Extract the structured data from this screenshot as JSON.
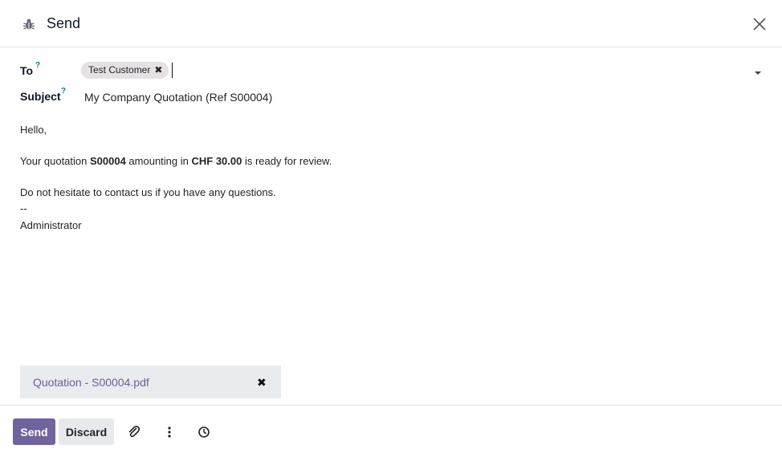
{
  "dialog": {
    "title": "Send",
    "title_icon": "bug-icon",
    "close_icon": "close-icon"
  },
  "to": {
    "label": "To",
    "help": "?",
    "recipients": [
      {
        "name": "Test Customer",
        "remove": "✖"
      }
    ],
    "value": "",
    "dropdown_icon": "caret-down-icon"
  },
  "subject": {
    "label": "Subject",
    "help": "?",
    "value": "My Company Quotation (Ref S00004)"
  },
  "body": {
    "greeting": "Hello,",
    "line2_pre": "Your quotation ",
    "ref": "S00004",
    "line2_mid": " amounting in ",
    "amount": "CHF 30.00",
    "line2_post": " is ready for review.",
    "line3": "Do not hesitate to contact us if you have any questions.",
    "sig_sep": "--",
    "signature": "Administrator"
  },
  "attachment": {
    "name": "Quotation - S00004.pdf",
    "remove": "✖"
  },
  "footer": {
    "send_label": "Send",
    "discard_label": "Discard",
    "icons": [
      "paperclip-icon",
      "more-vertical-icon",
      "clock-icon"
    ]
  },
  "colors": {
    "primary": "#71639e",
    "help": "#017e84",
    "tag_bg": "#e7e1e4",
    "attachment_link": "#6d5f8e"
  }
}
